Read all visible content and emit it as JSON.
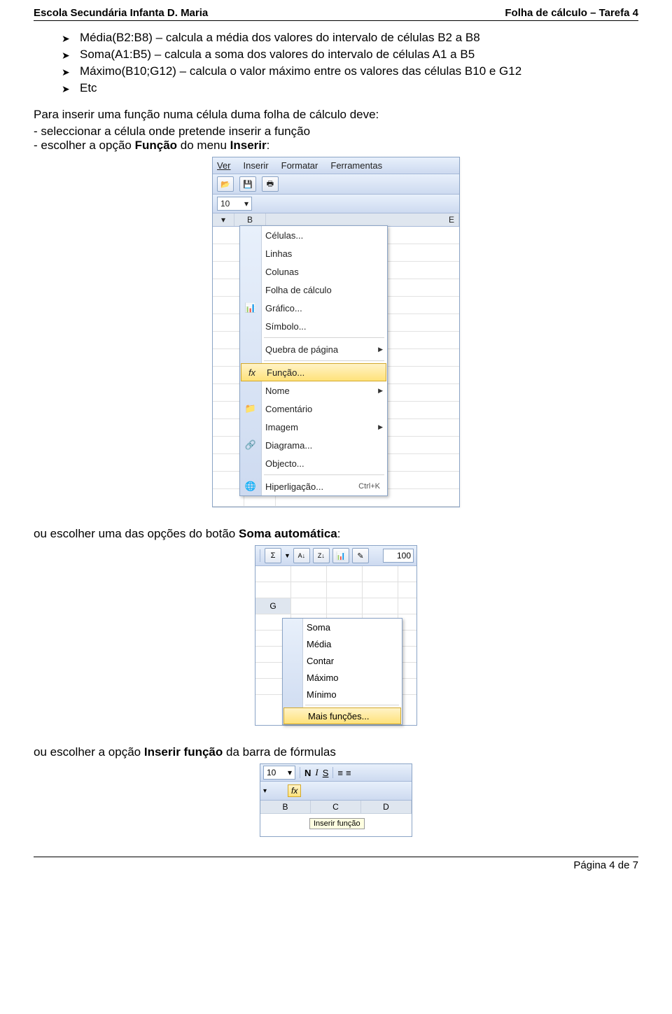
{
  "header": {
    "left": "Escola Secundária Infanta D. Maria",
    "right": "Folha de cálculo – Tarefa 4"
  },
  "bullets": [
    "Média(B2:B8) – calcula a média dos valores do intervalo de células B2 a B8",
    "Soma(A1:B5) – calcula a soma dos valores do intervalo de células A1 a B5",
    "Máximo(B10;G12) – calcula o valor máximo entre os valores das células B10 e G12",
    "Etc"
  ],
  "para1": "Para inserir uma função numa célula duma folha de cálculo deve:",
  "dash1": "- seleccionar a célula onde pretende inserir a função",
  "dash2_pre": "- escolher a opção ",
  "dash2_b1": "Função",
  "dash2_mid": " do menu ",
  "dash2_b2": "Inserir",
  "dash2_post": ":",
  "para2_pre": "ou escolher uma das opções do botão ",
  "para2_b": "Soma automática",
  "para2_post": ":",
  "para3_pre": "ou escolher a opção ",
  "para3_b": "Inserir função",
  "para3_post": " da barra de fórmulas",
  "footer": "Página 4 de 7",
  "fig1": {
    "menubar": [
      "Ver",
      "Inserir",
      "Formatar",
      "Ferramentas"
    ],
    "fontsize": "10",
    "col_b": "B",
    "col_e": "E",
    "items": {
      "celulas": "Células...",
      "linhas": "Linhas",
      "colunas": "Colunas",
      "folha": "Folha de cálculo",
      "grafico": "Gráfico...",
      "simbolo": "Símbolo...",
      "quebra": "Quebra de página",
      "funcao": "Função...",
      "nome": "Nome",
      "comentario": "Comentário",
      "imagem": "Imagem",
      "diagrama": "Diagrama...",
      "objecto": "Objecto...",
      "hiper": "Hiperligação...",
      "hiper_sc": "Ctrl+K"
    },
    "icon_fx": "fx"
  },
  "fig2": {
    "sigma": "Σ",
    "sort_az": "A↓",
    "sort_za": "Z↓",
    "hundred": "100",
    "col_g": "G",
    "items": {
      "soma": "Soma",
      "media": "Média",
      "contar": "Contar",
      "maximo": "Máximo",
      "minimo": "Mínimo",
      "mais": "Mais funções..."
    }
  },
  "fig3": {
    "fontsize": "10",
    "n": "N",
    "i": "I",
    "s": "S",
    "align": "≡",
    "fx": "fx",
    "col_b": "B",
    "col_c": "C",
    "col_d": "D",
    "tooltip": "Inserir função"
  }
}
